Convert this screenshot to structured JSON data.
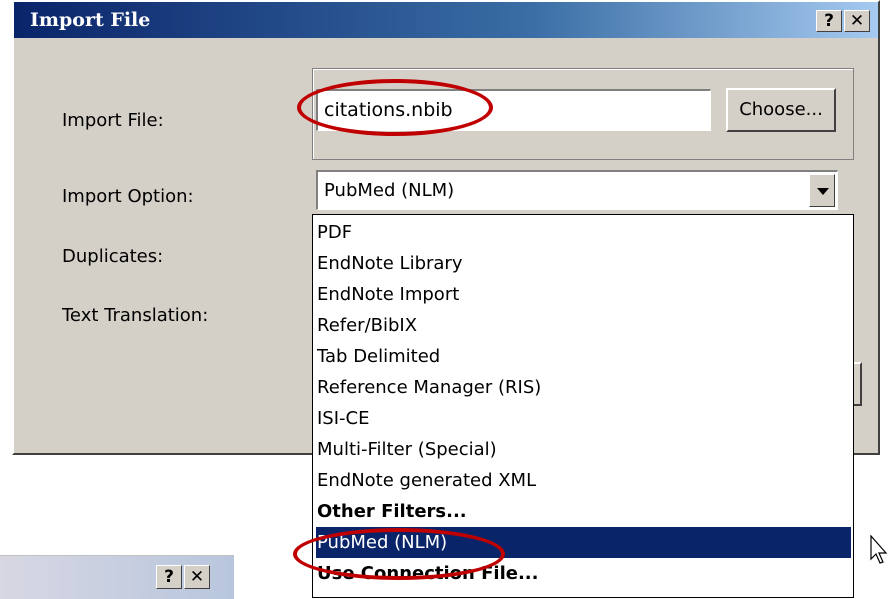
{
  "dialog": {
    "title": "Import File",
    "help_label": "?",
    "close_label": "✕",
    "labels": {
      "import_file": "Import File:",
      "import_option": "Import Option:",
      "duplicates": "Duplicates:",
      "text_translation": "Text Translation:"
    },
    "file_value": "citations.nbib",
    "choose_label": "Choose...",
    "import_option_value": "PubMed (NLM)"
  },
  "dropdown": {
    "options": [
      {
        "label": "PDF",
        "bold": false,
        "selected": false
      },
      {
        "label": "EndNote Library",
        "bold": false,
        "selected": false
      },
      {
        "label": "EndNote Import",
        "bold": false,
        "selected": false
      },
      {
        "label": "Refer/BibIX",
        "bold": false,
        "selected": false
      },
      {
        "label": "Tab Delimited",
        "bold": false,
        "selected": false
      },
      {
        "label": "Reference Manager (RIS)",
        "bold": false,
        "selected": false
      },
      {
        "label": "ISI-CE",
        "bold": false,
        "selected": false
      },
      {
        "label": "Multi-Filter (Special)",
        "bold": false,
        "selected": false
      },
      {
        "label": "EndNote generated XML",
        "bold": false,
        "selected": false
      },
      {
        "label": "Other Filters...",
        "bold": true,
        "selected": false
      },
      {
        "label": "PubMed (NLM)",
        "bold": false,
        "selected": true
      },
      {
        "label": "Use Connection File...",
        "bold": true,
        "selected": false
      }
    ]
  },
  "background_dialog": {
    "help_label": "?",
    "close_label": "✕"
  },
  "colors": {
    "accent": "#0a246a",
    "annotation": "#c00000",
    "dialog_bg": "#d4d0c8"
  },
  "icons": [
    "help-icon",
    "close-icon",
    "dropdown-arrow-icon",
    "mouse-cursor-icon"
  ]
}
